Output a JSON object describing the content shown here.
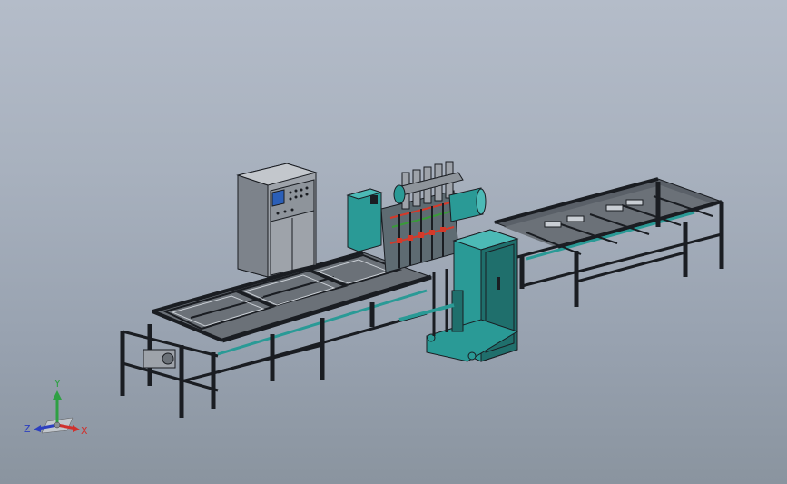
{
  "viewport": {
    "background_top": "#b4bcc9",
    "background_bottom": "#8a949f"
  },
  "model": {
    "frame_color": "#1a1d22",
    "machine_color": "#2a9a96",
    "machine_dark": "#1f6f6c",
    "cabinet_color": "#9ea3aa",
    "hmi_screen_color": "#2b5fb8",
    "electrode_colors": [
      "#d43a2a",
      "#3a9a3a"
    ]
  },
  "triad": {
    "x_label": "X",
    "y_label": "Y",
    "z_label": "Z",
    "x_color": "#d0312d",
    "y_color": "#2ea043",
    "z_color": "#2c3fbf"
  }
}
